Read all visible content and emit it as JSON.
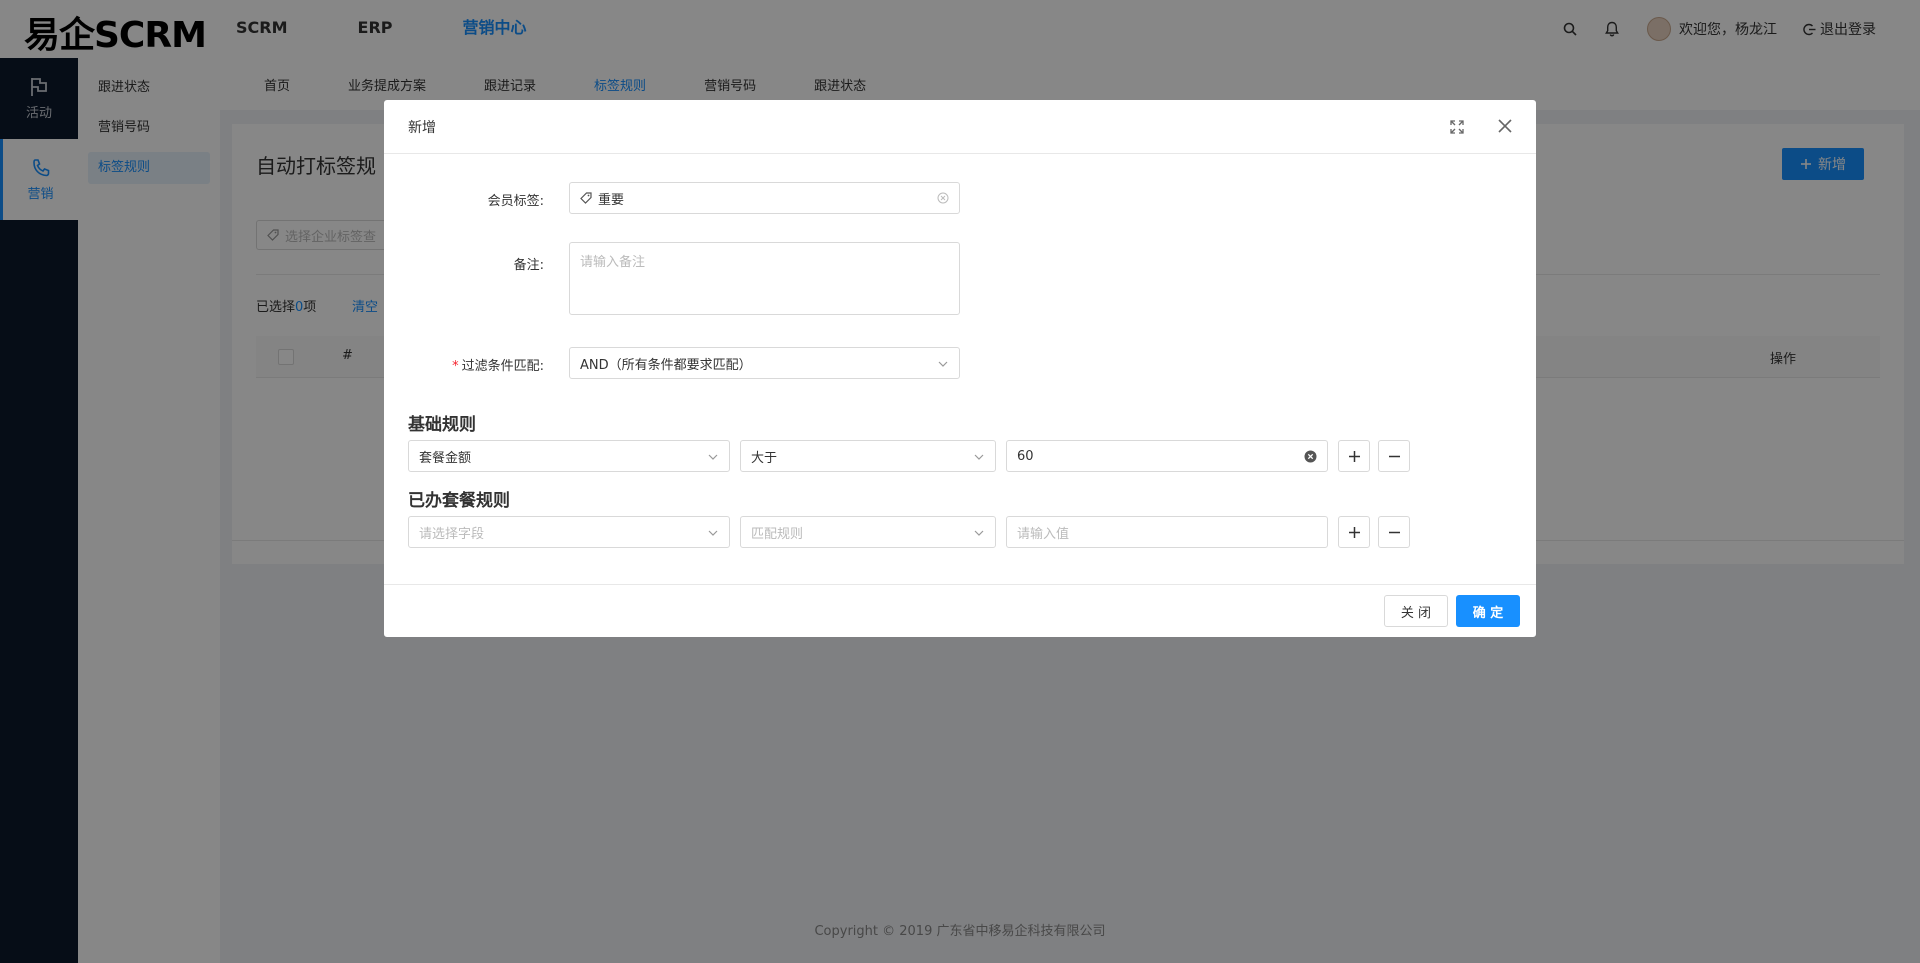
{
  "app": {
    "logo": "易企SCRM"
  },
  "topnav": {
    "items": [
      "SCRM",
      "ERP",
      "营销中心"
    ],
    "active_index": 2
  },
  "user": {
    "welcome": "欢迎您，杨龙江",
    "logout": "退出登录"
  },
  "leftbar": {
    "items": [
      {
        "label": "活动",
        "icon": "flag-icon"
      },
      {
        "label": "营销",
        "icon": "phone-icon"
      }
    ],
    "active_index": 1
  },
  "subside": {
    "items": [
      "跟进状态",
      "营销号码",
      "标签规则"
    ],
    "active_index": 2
  },
  "subnav": {
    "tabs": [
      "首页",
      "业务提成方案",
      "跟进记录",
      "标签规则",
      "营销号码",
      "跟进状态"
    ],
    "active_index": 3
  },
  "content": {
    "title": "自动打标签规",
    "add_button": "新增",
    "filter_placeholder": "选择企业标签查",
    "selected_prefix": "已选择",
    "selected_count": "0",
    "selected_suffix": "项",
    "clear": "清空",
    "table_headers": {
      "index": "#",
      "operation": "操作"
    }
  },
  "copyright": "Copyright © 2019 广东省中移易企科技有限公司",
  "modal": {
    "title": "新增",
    "member_tag_label": "会员标签:",
    "member_tag_value": "重要",
    "remark_label": "备注:",
    "remark_placeholder": "请输入备注",
    "filter_match_label": "过滤条件匹配:",
    "filter_match_value": "AND（所有条件都要求匹配）",
    "basic_rules_title": "基础规则",
    "basic_rule": {
      "field": "套餐金额",
      "operator": "大于",
      "value": "60"
    },
    "package_rules_title": "已办套餐规则",
    "package_rule": {
      "field_placeholder": "请选择字段",
      "operator_placeholder": "匹配规则",
      "value_placeholder": "请输入值"
    },
    "close_button": "关 闭",
    "ok_button": "确 定"
  }
}
